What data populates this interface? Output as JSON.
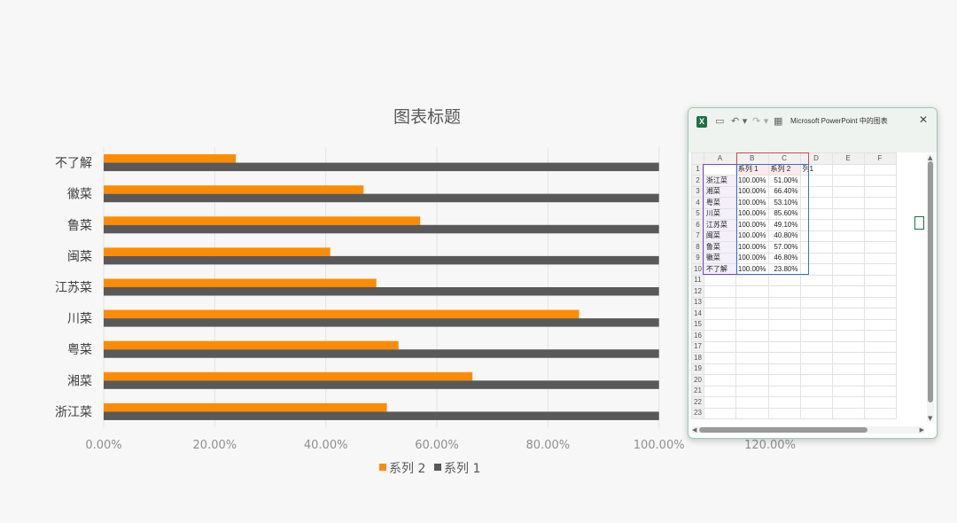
{
  "chart_data": {
    "type": "bar",
    "orientation": "horizontal",
    "title": "图表标题",
    "categories": [
      "浙江菜",
      "湘菜",
      "粤菜",
      "川菜",
      "江苏菜",
      "闽菜",
      "鲁菜",
      "徽菜",
      "不了解"
    ],
    "series": [
      {
        "name": "系列 1",
        "values": [
          1.0,
          1.0,
          1.0,
          1.0,
          1.0,
          1.0,
          1.0,
          1.0,
          1.0
        ]
      },
      {
        "name": "系列 2",
        "values": [
          0.51,
          0.664,
          0.531,
          0.856,
          0.491,
          0.408,
          0.57,
          0.468,
          0.238
        ]
      }
    ],
    "xlim": [
      0,
      1.2
    ],
    "xticks": [
      "0.00%",
      "20.00%",
      "40.00%",
      "60.00%",
      "80.00%",
      "100.00%",
      "120.00%"
    ],
    "grid": true,
    "legend_position": "bottom",
    "colors": {
      "系列 1": "#595959",
      "系列 2": "#ff8c00"
    }
  },
  "legend": {
    "items": [
      {
        "label": "系列 2",
        "color": "#ff8c00"
      },
      {
        "label": "系列 1",
        "color": "#595959"
      }
    ]
  },
  "excel": {
    "title": "Microsoft PowerPoint 中的图表",
    "icons": [
      "excel-icon",
      "save-icon",
      "undo-icon",
      "redo-icon",
      "edit-data-icon",
      "close-icon"
    ],
    "close_label": "✕",
    "columns": [
      "",
      "A",
      "B",
      "C",
      "D",
      "E",
      "F"
    ],
    "rows": [
      [
        "1",
        "",
        "系列 1",
        "系列 2",
        "列1",
        "",
        ""
      ],
      [
        "2",
        "浙江菜",
        "100.00%",
        "51.00%",
        "",
        "",
        ""
      ],
      [
        "3",
        "湘菜",
        "100.00%",
        "66.40%",
        "",
        "",
        ""
      ],
      [
        "4",
        "粤菜",
        "100.00%",
        "53.10%",
        "",
        "",
        ""
      ],
      [
        "5",
        "川菜",
        "100.00%",
        "85.60%",
        "",
        "",
        ""
      ],
      [
        "6",
        "江苏菜",
        "100.00%",
        "49.10%",
        "",
        "",
        ""
      ],
      [
        "7",
        "闽菜",
        "100.00%",
        "40.80%",
        "",
        "",
        ""
      ],
      [
        "8",
        "鲁菜",
        "100.00%",
        "57.00%",
        "",
        "",
        ""
      ],
      [
        "9",
        "徽菜",
        "100.00%",
        "46.80%",
        "",
        "",
        ""
      ],
      [
        "10",
        "不了解",
        "100.00%",
        "23.80%",
        "",
        "",
        ""
      ],
      [
        "11",
        "",
        "",
        "",
        "",
        "",
        ""
      ],
      [
        "12",
        "",
        "",
        "",
        "",
        "",
        ""
      ],
      [
        "13",
        "",
        "",
        "",
        "",
        "",
        ""
      ],
      [
        "14",
        "",
        "",
        "",
        "",
        "",
        ""
      ],
      [
        "15",
        "",
        "",
        "",
        "",
        "",
        ""
      ],
      [
        "16",
        "",
        "",
        "",
        "",
        "",
        ""
      ],
      [
        "17",
        "",
        "",
        "",
        "",
        "",
        ""
      ],
      [
        "18",
        "",
        "",
        "",
        "",
        "",
        ""
      ],
      [
        "19",
        "",
        "",
        "",
        "",
        "",
        ""
      ],
      [
        "20",
        "",
        "",
        "",
        "",
        "",
        ""
      ],
      [
        "21",
        "",
        "",
        "",
        "",
        "",
        ""
      ],
      [
        "22",
        "",
        "",
        "",
        "",
        "",
        ""
      ],
      [
        "23",
        "",
        "",
        "",
        "",
        "",
        ""
      ]
    ]
  }
}
